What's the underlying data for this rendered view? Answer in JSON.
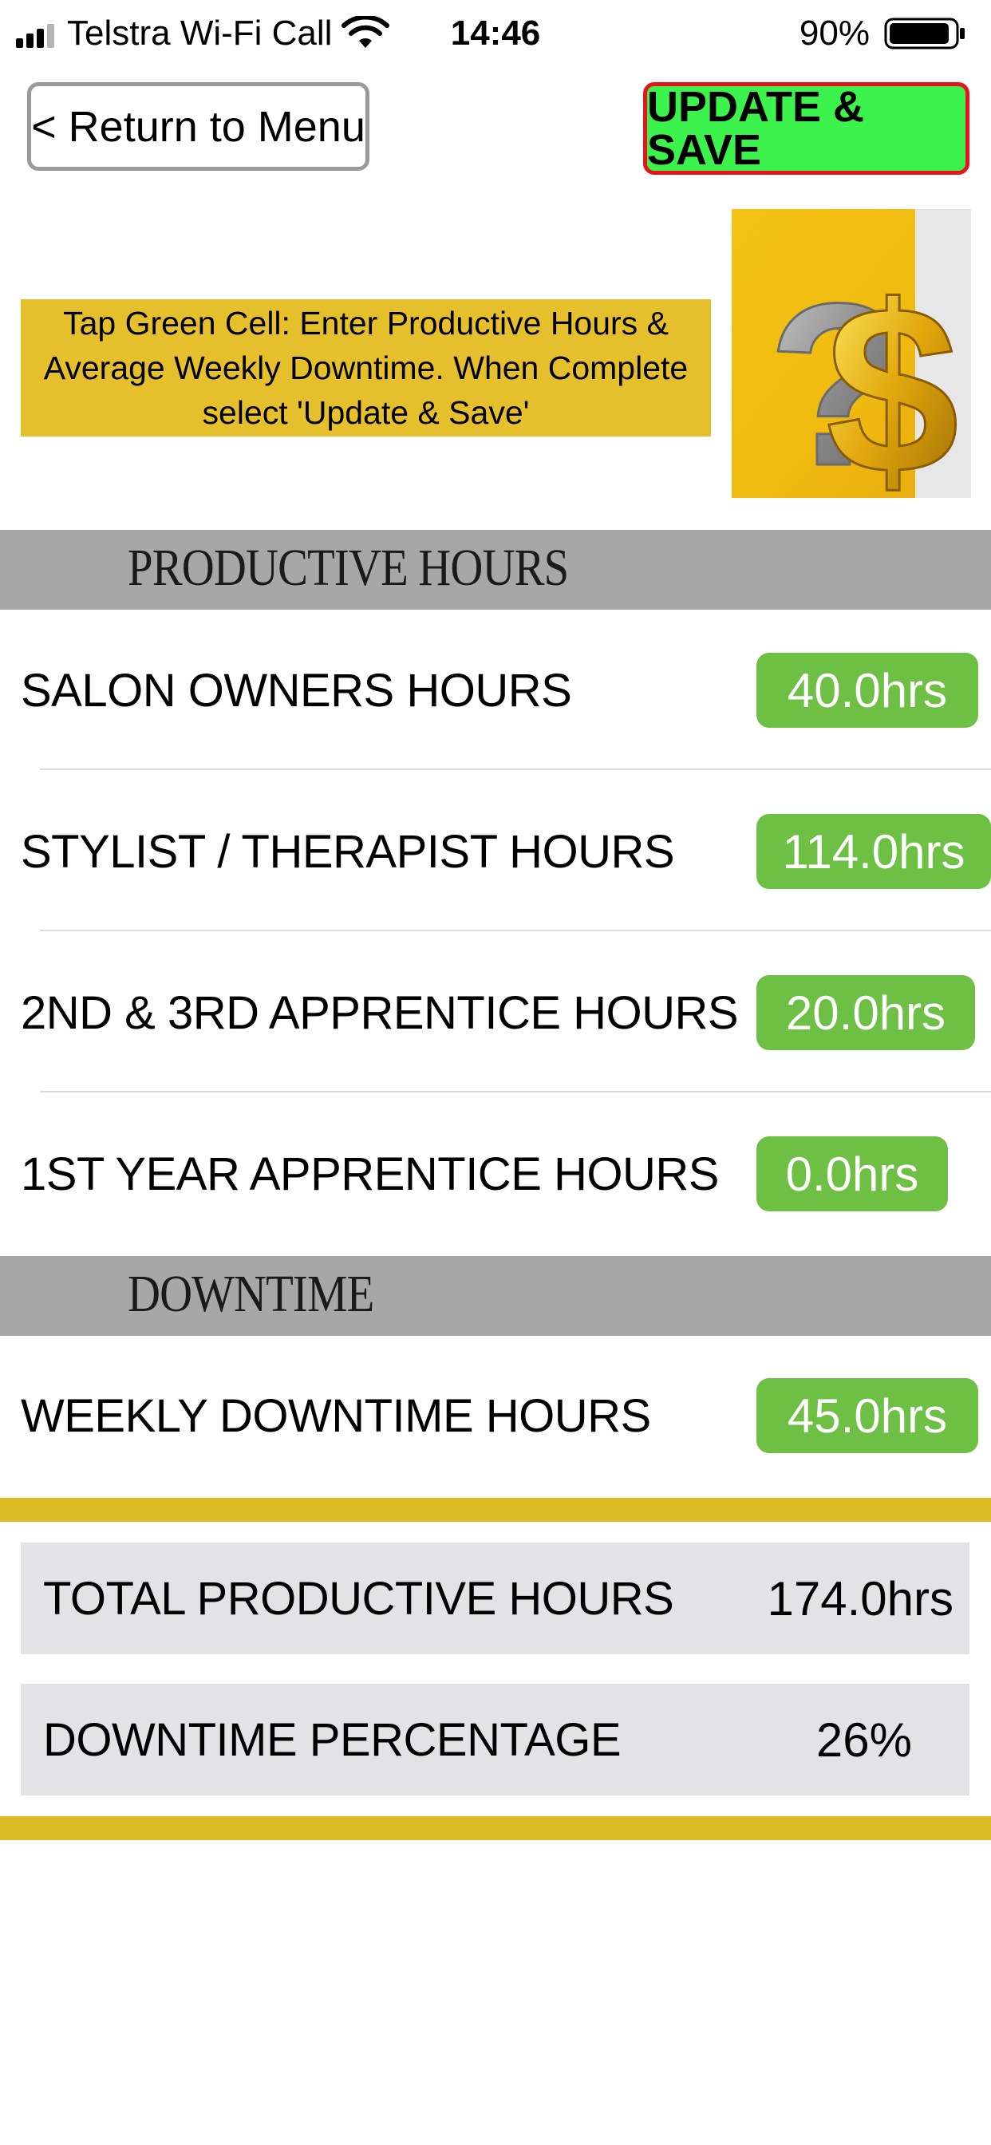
{
  "status_bar": {
    "carrier": "Telstra Wi-Fi Call",
    "time": "14:46",
    "battery_percent": "90%"
  },
  "toolbar": {
    "return_label": "< Return to Menu",
    "save_label": "UPDATE & SAVE"
  },
  "instruction": "Tap Green Cell: Enter Productive Hours & Average Weekly Downtime. When Complete select 'Update & Save'",
  "sections": {
    "productive": {
      "title": "PRODUCTIVE HOURS",
      "rows": [
        {
          "label": "SALON OWNERS HOURS",
          "value": "40.0hrs"
        },
        {
          "label": "STYLIST / THERAPIST HOURS",
          "value": "114.0hrs"
        },
        {
          "label": "2ND & 3RD APPRENTICE HOURS",
          "value": "20.0hrs"
        },
        {
          "label": "1ST YEAR APPRENTICE HOURS",
          "value": "0.0hrs"
        }
      ]
    },
    "downtime": {
      "title": "DOWNTIME",
      "rows": [
        {
          "label": "WEEKLY DOWNTIME HOURS",
          "value": "45.0hrs"
        }
      ]
    }
  },
  "totals": [
    {
      "label": "TOTAL PRODUCTIVE HOURS",
      "value": "174.0hrs"
    },
    {
      "label": "DOWNTIME PERCENTAGE",
      "value": "26%"
    }
  ],
  "icons": {
    "signal": "cellular-signal-icon",
    "wifi": "wifi-icon",
    "battery": "battery-icon",
    "logo": "question-dollar-logo"
  },
  "colors": {
    "save_button": "#3cf24c",
    "save_border": "#e8141c",
    "value_cell": "#6ec044",
    "instruction_bg": "#e6bf2c",
    "section_header": "#a7a7a7",
    "gold_bar": "#dbbb26",
    "totals_bg": "#e3e3e5"
  }
}
